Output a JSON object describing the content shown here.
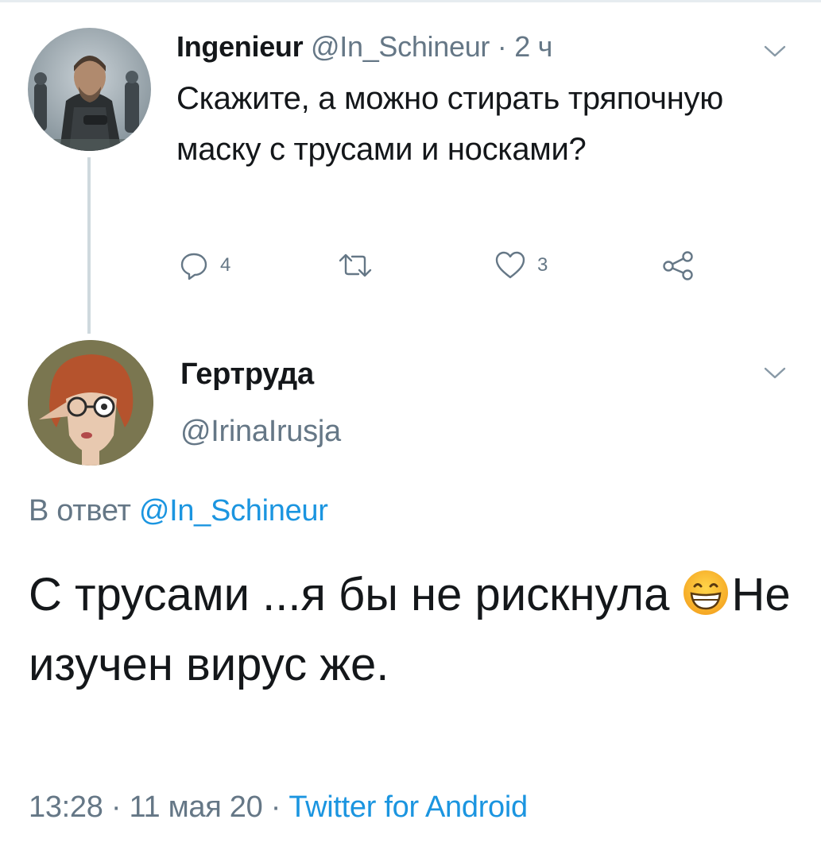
{
  "parent_tweet": {
    "author_name": "Ingenieur",
    "author_handle": "@In_Schineur",
    "separator": " · ",
    "time": "2 ч",
    "text": "Скажите, а можно стирать тряпочную маску с трусами и носками?",
    "actions": {
      "reply_count": "4",
      "retweet_count": "",
      "like_count": "3"
    },
    "icons": [
      "chevron-down-icon",
      "reply-icon",
      "retweet-icon",
      "like-icon",
      "share-icon"
    ]
  },
  "reply_tweet": {
    "author_name": "Гертруда",
    "author_handle": "@IrinaIrusja",
    "reply_to_prefix": "В ответ ",
    "reply_to_handle": "@In_Schineur",
    "text_part1": "С трусами ...я бы не рискнула ",
    "emoji": "grinning-face-emoji",
    "text_part2": "Не изучен вирус же.",
    "time": "13:28",
    "date": "11 мая 20",
    "meta_separator": " · ",
    "source": "Twitter for Android"
  },
  "colors": {
    "text": "#14171a",
    "muted": "#657786",
    "link": "#1b95e0",
    "thread_line": "#cfd9de"
  }
}
